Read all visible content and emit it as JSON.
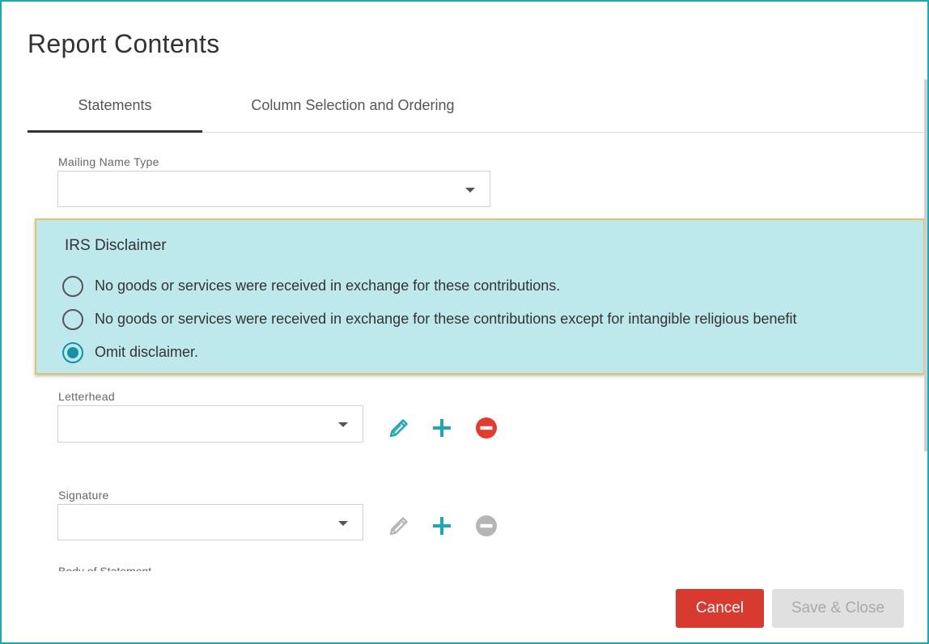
{
  "dialog": {
    "title": "Report Contents"
  },
  "tabs": [
    {
      "label": "Statements",
      "active": true
    },
    {
      "label": "Column Selection and Ordering",
      "active": false
    }
  ],
  "mailing_name_type": {
    "label": "Mailing Name Type",
    "value": ""
  },
  "irs_disclaimer": {
    "title": "IRS Disclaimer",
    "options": [
      {
        "label": "No goods or services were received in exchange for these contributions.",
        "checked": false
      },
      {
        "label": "No goods or services were received in exchange for these contributions except for intangible religious benefit",
        "checked": false
      },
      {
        "label": "Omit disclaimer.",
        "checked": true
      }
    ]
  },
  "letterhead": {
    "label": "Letterhead",
    "value": "",
    "actions": {
      "edit": "enabled",
      "add": "enabled",
      "remove": "enabled"
    }
  },
  "signature": {
    "label": "Signature",
    "value": "",
    "actions": {
      "edit": "disabled",
      "add": "enabled",
      "remove": "disabled"
    }
  },
  "body_of_statement": {
    "label": "Body of Statement"
  },
  "footer": {
    "cancel_label": "Cancel",
    "save_label": "Save & Close"
  },
  "colors": {
    "accent": "#1ba9b8",
    "panel_bg": "#bde8ec",
    "panel_border": "#e3c567",
    "danger": "#d93a2f",
    "disabled": "#a9a9a9"
  }
}
